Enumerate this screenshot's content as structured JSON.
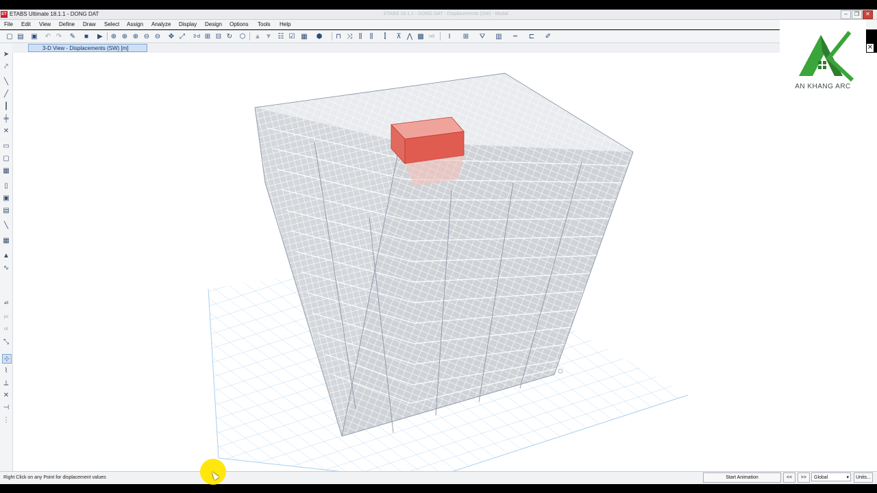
{
  "window": {
    "title": "ETABS Ultimate 18.1.1 - DONG DAT",
    "ghost_title": "ETABS 18.1.1 - DONG DAT - Displacements (SW) - Modal",
    "app_icon": "ET"
  },
  "menubar": {
    "items": [
      "File",
      "Edit",
      "View",
      "Define",
      "Draw",
      "Select",
      "Assign",
      "Analyze",
      "Display",
      "Design",
      "Options",
      "Tools",
      "Help"
    ]
  },
  "toolbar": {
    "text_labels": {
      "threed": "3-d",
      "nd": "nd"
    }
  },
  "left_toolbar": {
    "labels": {
      "all": "all",
      "ps": "ps",
      "clr": "clr"
    }
  },
  "tabs": {
    "active": "3-D View  - Displacements (SW)  [m]"
  },
  "logo": {
    "brand": "AN KHANG ARC",
    "color_primary": "#3aa53a",
    "color_dark": "#2d7d2d"
  },
  "status": {
    "message": "Right Click on any Point for displacement values",
    "start_animation": "Start Animation",
    "prev": "<<",
    "next": ">>",
    "coord_system": "Global",
    "units": "Units..."
  },
  "colors": {
    "highlight_box": "#e05b50",
    "grid": "#9ec6e8",
    "frame": "#8d97a8"
  }
}
